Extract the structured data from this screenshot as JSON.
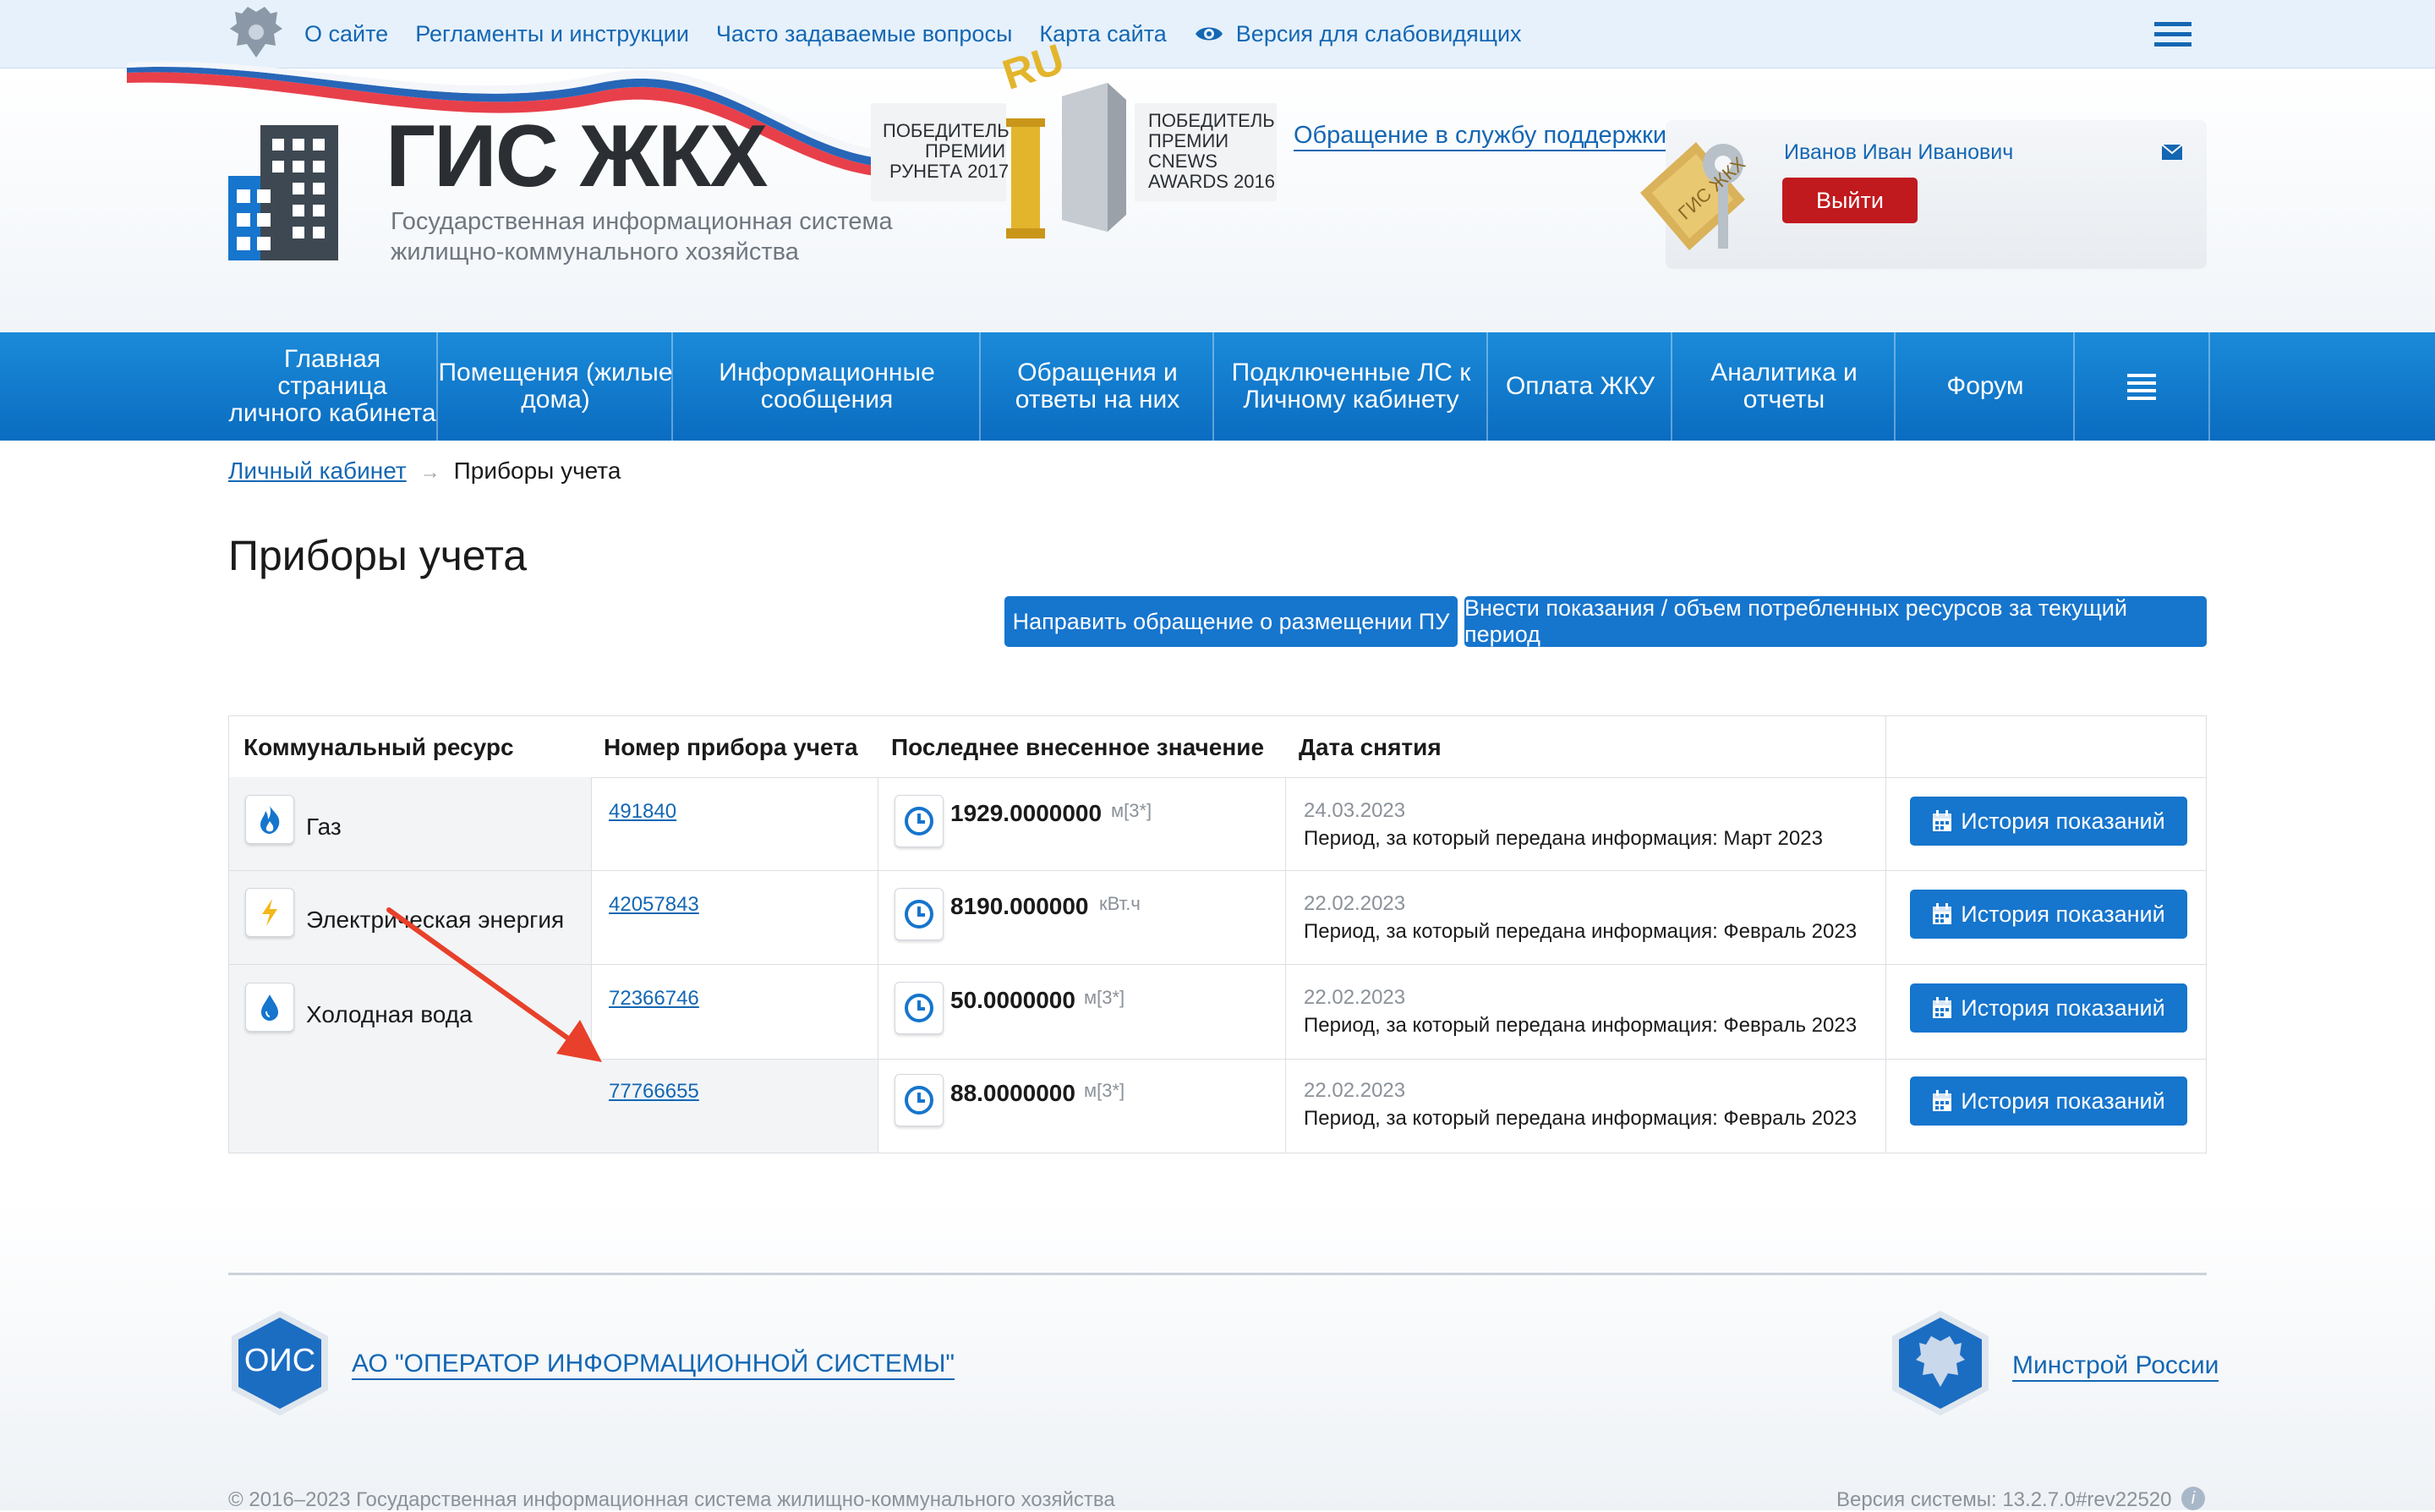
{
  "topbar": {
    "links": [
      "О сайте",
      "Регламенты и инструкции",
      "Часто задаваемые вопросы",
      "Карта сайта"
    ],
    "accessibility_label": "Версия для слабовидящих"
  },
  "header": {
    "logo_title": "ГИС ЖКХ",
    "logo_subtitle_1": "Государственная информационная система",
    "logo_subtitle_2": "жилищно-коммунального хозяйства",
    "award1_line1": "ПОБЕДИТЕЛЬ",
    "award1_line2": "ПРЕМИИ",
    "award1_line3": "РУНЕТА 2017",
    "award_ru": "RU",
    "award2_line1": "ПОБЕДИТЕЛЬ",
    "award2_line2": "ПРЕМИИ",
    "award2_line3": "CNEWS",
    "award2_line4": "AWARDS 2016",
    "support_link": "Обращение в службу поддержки",
    "user_name": "Иванов Иван Иванович",
    "logout_label": "Выйти",
    "key_tag": "ГИС ЖКХ"
  },
  "mainnav": [
    "Главная страница личного кабинета",
    "Помещения (жилые дома)",
    "Информационные сообщения",
    "Обращения и ответы на них",
    "Подключенные ЛС к Личному кабинету",
    "Оплата ЖКУ",
    "Аналитика и отчеты",
    "Форум"
  ],
  "breadcrumb": {
    "root": "Личный кабинет",
    "arrow": "→",
    "current": "Приборы учета"
  },
  "page": {
    "title": "Приборы учета",
    "btn_request": "Направить обращение о размещении ПУ",
    "btn_submit": "Внести показания / объем потребленных ресурсов за текущий период"
  },
  "table": {
    "headers": [
      "Коммунальный ресурс",
      "Номер прибора учета",
      "Последнее внесенное значение",
      "Дата снятия"
    ],
    "history_label": "История показаний",
    "rows": [
      {
        "resource": "Газ",
        "meter": "491840",
        "value": "1929.0000000",
        "unit": "м[3*]",
        "date": "24.03.2023",
        "period": "Период, за который передана информация: Март 2023"
      },
      {
        "resource": "Электрическая энергия",
        "meter": "42057843",
        "value": "8190.000000",
        "unit": "кВт.ч",
        "date": "22.02.2023",
        "period": "Период, за который передана информация: Февраль 2023"
      },
      {
        "resource": "Холодная вода",
        "meter": "72366746",
        "value": "50.0000000",
        "unit": "м[3*]",
        "date": "22.02.2023",
        "period": "Период, за который передана информация: Февраль 2023"
      },
      {
        "resource": "",
        "meter": "77766655",
        "value": "88.0000000",
        "unit": "м[3*]",
        "date": "22.02.2023",
        "period": "Период, за который передана информация: Февраль 2023"
      }
    ]
  },
  "footer": {
    "ois_badge": "ОИС",
    "ois_link": "АО \"ОПЕРАТОР ИНФОРМАЦИОННОЙ СИСТЕМЫ\"",
    "minstroy_link": "Минстрой России",
    "copyright": "© 2016–2023 Государственная информационная система жилищно-коммунального хозяйства",
    "version": "Версия системы: 13.2.7.0#rev22520"
  },
  "colors": {
    "brand_blue": "#1675cd",
    "link_blue": "#1467b3",
    "logout_red": "#c0191e",
    "annotation_arrow": "#e8402a"
  }
}
